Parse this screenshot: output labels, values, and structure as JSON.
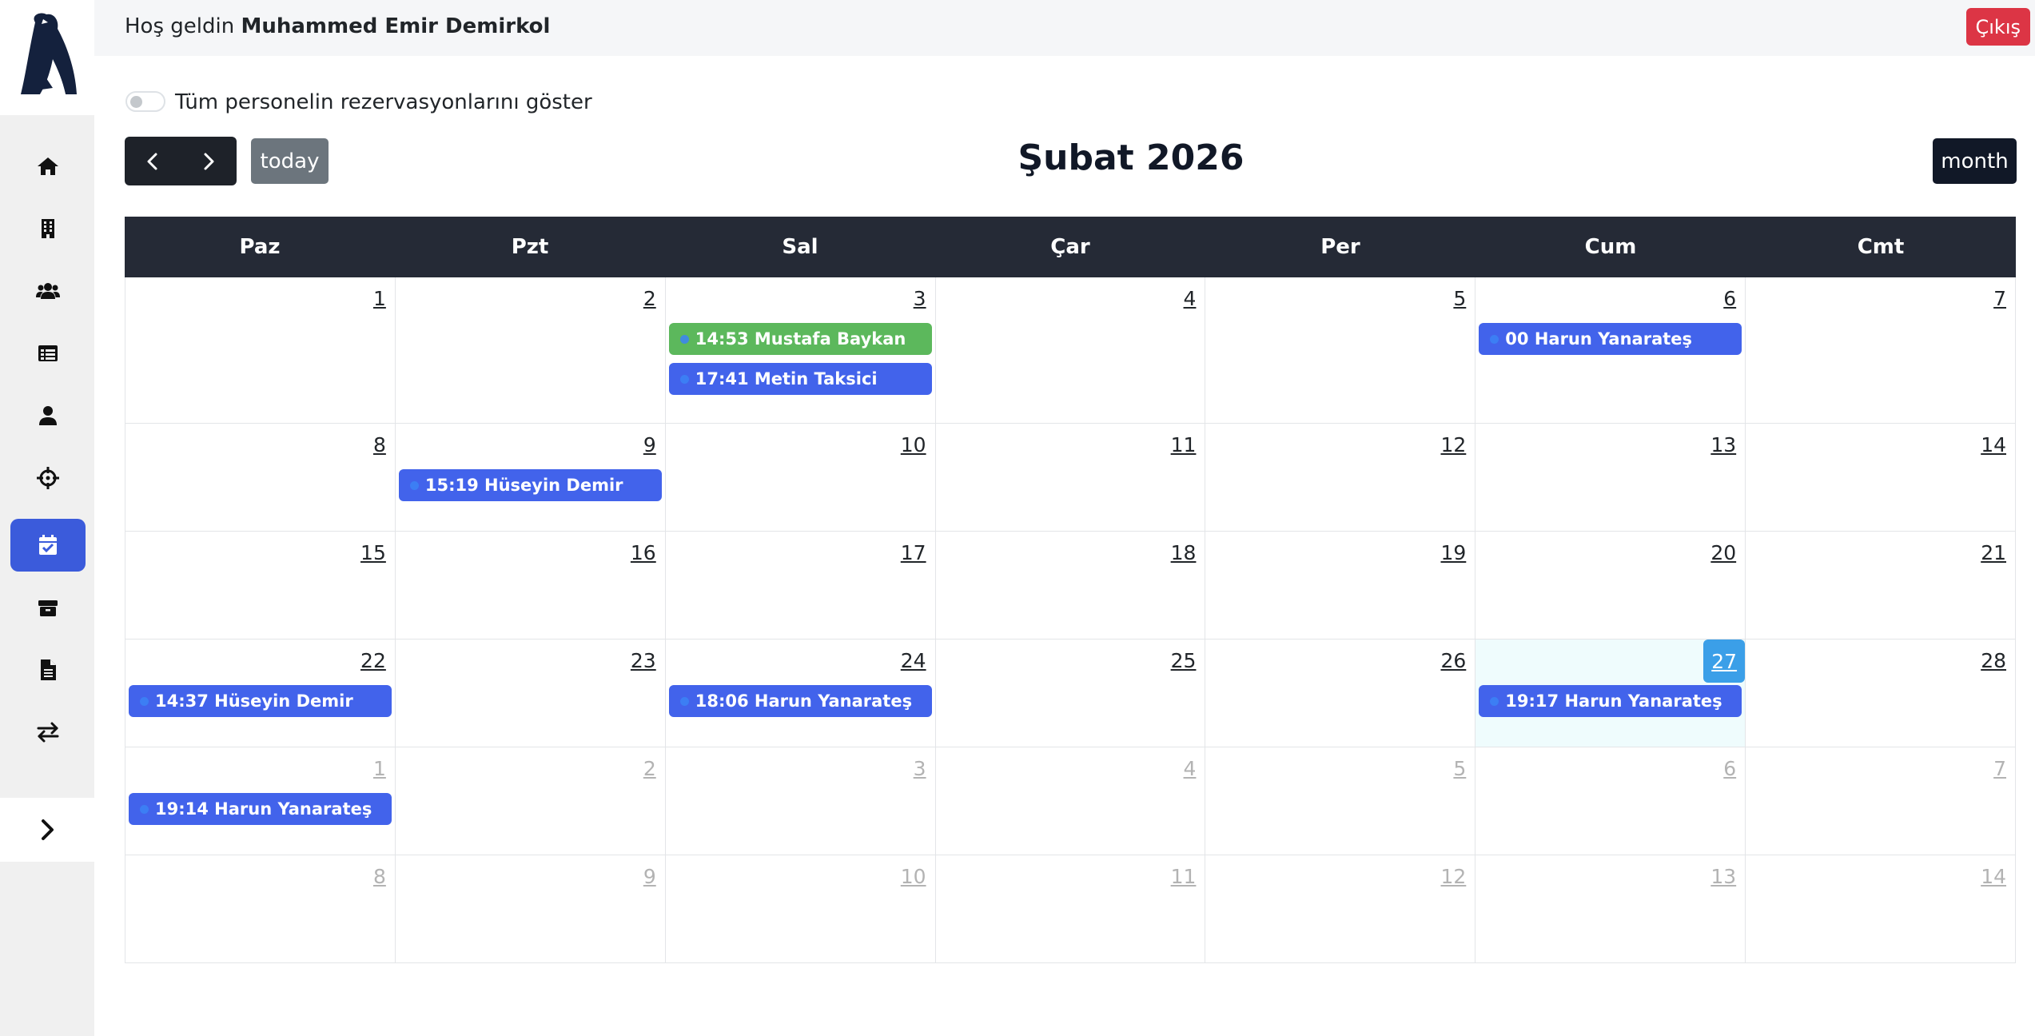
{
  "header": {
    "welcome_prefix": "Hoş geldin",
    "user_name": "Muhammed Emir Demirkol",
    "logout_label": "Çıkış"
  },
  "sidebar": {
    "items": [
      {
        "icon": "home-icon"
      },
      {
        "icon": "building-icon"
      },
      {
        "icon": "users-icon"
      },
      {
        "icon": "table-list-icon"
      },
      {
        "icon": "user-icon"
      },
      {
        "icon": "crosshairs-icon"
      },
      {
        "icon": "calendar-check-icon",
        "active": true
      },
      {
        "icon": "box-icon"
      },
      {
        "icon": "file-icon"
      },
      {
        "icon": "exchange-icon"
      }
    ],
    "expand_icon": "chevron-right-icon"
  },
  "toggle": {
    "label": "Tüm personelin rezervasyonlarını göster",
    "checked": false
  },
  "toolbar": {
    "today_label": "today",
    "title": "Şubat 2026",
    "view_label": "month"
  },
  "calendar": {
    "weekdays": [
      "Paz",
      "Pzt",
      "Sal",
      "Çar",
      "Per",
      "Cum",
      "Cmt"
    ],
    "weeks": [
      [
        {
          "day": "1"
        },
        {
          "day": "2"
        },
        {
          "day": "3",
          "events": [
            {
              "text": "14:53 Mustafa Baykan",
              "color": "#5cb85c"
            },
            {
              "text": "17:41 Metin Taksici",
              "color": "#4263eb"
            }
          ]
        },
        {
          "day": "4"
        },
        {
          "day": "5"
        },
        {
          "day": "6",
          "events": [
            {
              "text": "00 Harun Yanarateş",
              "color": "#4263eb"
            }
          ]
        },
        {
          "day": "7"
        }
      ],
      [
        {
          "day": "8"
        },
        {
          "day": "9",
          "events": [
            {
              "text": "15:19 Hüseyin Demir",
              "color": "#4263eb"
            }
          ]
        },
        {
          "day": "10"
        },
        {
          "day": "11"
        },
        {
          "day": "12"
        },
        {
          "day": "13"
        },
        {
          "day": "14"
        }
      ],
      [
        {
          "day": "15"
        },
        {
          "day": "16"
        },
        {
          "day": "17"
        },
        {
          "day": "18"
        },
        {
          "day": "19"
        },
        {
          "day": "20"
        },
        {
          "day": "21"
        }
      ],
      [
        {
          "day": "22",
          "events": [
            {
              "text": "14:37 Hüseyin Demir",
              "color": "#4263eb"
            }
          ]
        },
        {
          "day": "23"
        },
        {
          "day": "24",
          "events": [
            {
              "text": "18:06 Harun Yanarateş",
              "color": "#4263eb"
            }
          ]
        },
        {
          "day": "25"
        },
        {
          "day": "26"
        },
        {
          "day": "27",
          "today": true,
          "events": [
            {
              "text": "19:17 Harun Yanarateş",
              "color": "#4263eb"
            }
          ]
        },
        {
          "day": "28"
        }
      ],
      [
        {
          "day": "1",
          "other": true,
          "events": [
            {
              "text": "19:14 Harun Yanarateş",
              "color": "#4263eb"
            }
          ]
        },
        {
          "day": "2",
          "other": true
        },
        {
          "day": "3",
          "other": true
        },
        {
          "day": "4",
          "other": true
        },
        {
          "day": "5",
          "other": true
        },
        {
          "day": "6",
          "other": true
        },
        {
          "day": "7",
          "other": true
        }
      ],
      [
        {
          "day": "8",
          "other": true
        },
        {
          "day": "9",
          "other": true
        },
        {
          "day": "10",
          "other": true
        },
        {
          "day": "11",
          "other": true
        },
        {
          "day": "12",
          "other": true
        },
        {
          "day": "13",
          "other": true
        },
        {
          "day": "14",
          "other": true
        }
      ]
    ]
  }
}
